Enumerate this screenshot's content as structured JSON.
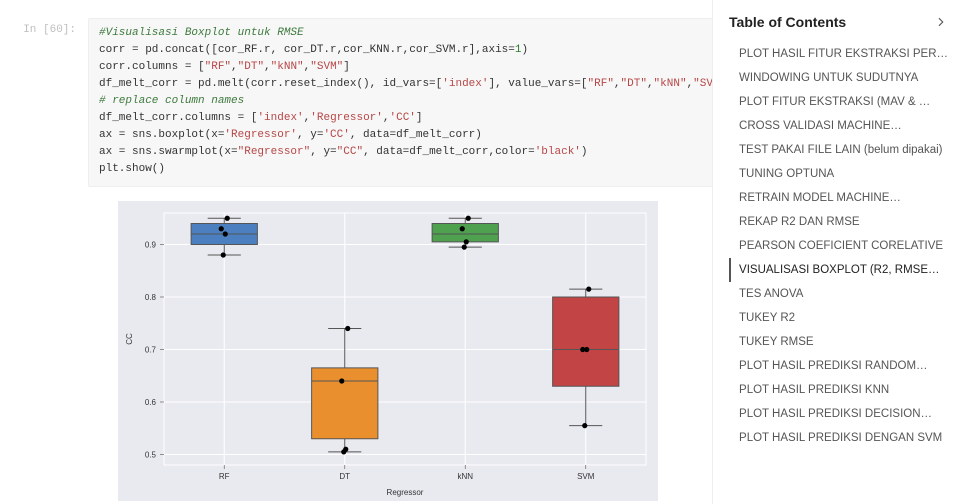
{
  "cell": {
    "prompt": "In [60]:",
    "lines": [
      {
        "type": "comment",
        "text": "#Visualisasi Boxplot untuk RMSE"
      },
      {
        "type": "plain",
        "text": "corr = pd.concat([cor_RF.r, cor_DT.r,cor_KNN.r,cor_SVM.r],axis=1)"
      },
      {
        "type": "cols",
        "prefix": "corr.columns = [",
        "items": [
          "\"RF\"",
          "\"DT\"",
          "\"kNN\"",
          "\"SVM\""
        ],
        "suffix": "]"
      },
      {
        "type": "melt",
        "prefix": "df_melt_corr = pd.melt(corr.reset_index(), id_vars=[",
        "idv": "'index'",
        "mid": "], value_vars=[",
        "items": [
          "\"RF\"",
          "\"DT\"",
          "\"kNN\"",
          "\"SVM\""
        ],
        "suffix": "])"
      },
      {
        "type": "comment",
        "text": "# replace column names"
      },
      {
        "type": "cols",
        "prefix": "df_melt_corr.columns = [",
        "items": [
          "'index'",
          "'Regressor'",
          "'CC'"
        ],
        "suffix": "]"
      },
      {
        "type": "call",
        "prefix": "ax = sns.boxplot(x=",
        "a": "'Regressor'",
        "b": ", y=",
        "c": "'CC'",
        "d": ", data=df_melt_corr)"
      },
      {
        "type": "call2",
        "prefix": "ax = sns.swarmplot(x=",
        "a": "\"Regressor\"",
        "b": ", y=",
        "c": "\"CC\"",
        "d": ", data=df_melt_corr,color=",
        "e": "'black'",
        "f": ")"
      },
      {
        "type": "plain",
        "text": "plt.show()"
      }
    ]
  },
  "chart_data": {
    "type": "boxplot",
    "xlabel": "Regressor",
    "ylabel": "CC",
    "ylim": [
      0.48,
      0.96
    ],
    "categories": [
      "RF",
      "DT",
      "kNN",
      "SVM"
    ],
    "series": [
      {
        "name": "RF",
        "color": "#4c7fbf",
        "q1": 0.9,
        "median": 0.92,
        "q3": 0.94,
        "whisker_low": 0.88,
        "whisker_high": 0.95,
        "points": [
          0.88,
          0.92,
          0.93,
          0.95
        ]
      },
      {
        "name": "DT",
        "color": "#e98f2e",
        "q1": 0.53,
        "median": 0.64,
        "q3": 0.665,
        "whisker_low": 0.505,
        "whisker_high": 0.74,
        "points": [
          0.505,
          0.51,
          0.64,
          0.74
        ]
      },
      {
        "name": "kNN",
        "color": "#4fa04f",
        "q1": 0.905,
        "median": 0.92,
        "q3": 0.94,
        "whisker_low": 0.895,
        "whisker_high": 0.95,
        "points": [
          0.895,
          0.905,
          0.93,
          0.95
        ]
      },
      {
        "name": "SVM",
        "color": "#c24444",
        "q1": 0.63,
        "median": 0.7,
        "q3": 0.8,
        "whisker_low": 0.555,
        "whisker_high": 0.815,
        "points": [
          0.555,
          0.7,
          0.7,
          0.815
        ]
      }
    ],
    "yticks": [
      0.5,
      0.6,
      0.7,
      0.8,
      0.9
    ]
  },
  "toc": {
    "title": "Table of Contents",
    "items": [
      {
        "label": "PLOT HASIL FITUR EKSTRAKSI PER…",
        "active": false
      },
      {
        "label": "WINDOWING UNTUK SUDUTNYA",
        "active": false
      },
      {
        "label": "PLOT FITUR EKSTRAKSI (MAV & …",
        "active": false
      },
      {
        "label": "CROSS VALIDASI MACHINE…",
        "active": false
      },
      {
        "label": "TEST PAKAI FILE LAIN (belum dipakai)",
        "active": false
      },
      {
        "label": "TUNING OPTUNA",
        "active": false
      },
      {
        "label": "RETRAIN MODEL MACHINE…",
        "active": false
      },
      {
        "label": "REKAP R2 DAN RMSE",
        "active": false
      },
      {
        "label": "PEARSON COEFICIENT CORELATIVE",
        "active": false
      },
      {
        "label": "VISUALISASI BOXPLOT (R2, RMSE…",
        "active": true
      },
      {
        "label": "TES ANOVA",
        "active": false
      },
      {
        "label": "TUKEY R2",
        "active": false
      },
      {
        "label": "TUKEY RMSE",
        "active": false
      },
      {
        "label": "PLOT HASIL PREDIKSI RANDOM…",
        "active": false
      },
      {
        "label": "PLOT HASIL PREDIKSI KNN",
        "active": false
      },
      {
        "label": "PLOT HASIL PREDIKSI DECISION…",
        "active": false
      },
      {
        "label": "PLOT HASIL PREDIKSI DENGAN SVM",
        "active": false
      }
    ]
  }
}
